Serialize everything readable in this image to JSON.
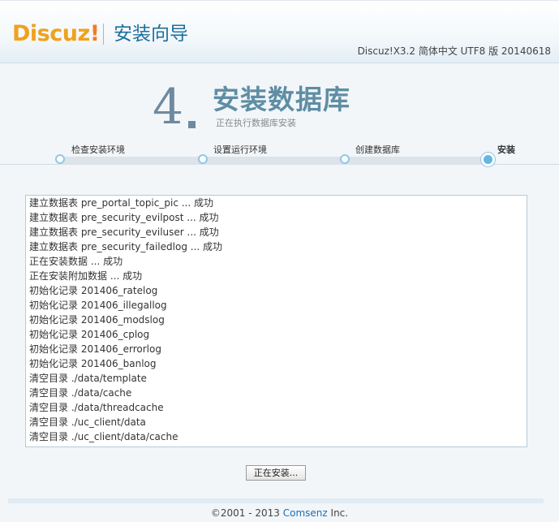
{
  "header": {
    "logo_text": "Discuz",
    "logo_mark": "!",
    "wizard_title": "安装向导",
    "version": "Discuz!X3.2 简体中文 UTF8 版 20140618"
  },
  "step": {
    "number": "4",
    "title": "安装数据库",
    "subtitle": "正在执行数据库安装"
  },
  "progress": {
    "steps": [
      {
        "label": "检查安装环境",
        "state": "done"
      },
      {
        "label": "设置运行环境",
        "state": "done"
      },
      {
        "label": "创建数据库",
        "state": "done"
      },
      {
        "label": "安装",
        "state": "current"
      }
    ]
  },
  "log": {
    "lines": [
      "建立数据表 pre_portal_topic_pic ... 成功",
      "建立数据表 pre_security_evilpost ... 成功",
      "建立数据表 pre_security_eviluser ... 成功",
      "建立数据表 pre_security_failedlog ... 成功",
      "正在安装数据 ... 成功",
      "正在安装附加数据 ... 成功",
      "初始化记录 201406_ratelog",
      "初始化记录 201406_illegallog",
      "初始化记录 201406_modslog",
      "初始化记录 201406_cplog",
      "初始化记录 201406_errorlog",
      "初始化记录 201406_banlog",
      "清空目录 ./data/template",
      "清空目录 ./data/cache",
      "清空目录 ./data/threadcache",
      "清空目录 ./uc_client/data",
      "清空目录 ./uc_client/data/cache"
    ]
  },
  "button": {
    "label": "正在安装..."
  },
  "footer": {
    "copyright": "©2001 - 2013 ",
    "company": "Comsenz",
    "suffix": " Inc."
  }
}
